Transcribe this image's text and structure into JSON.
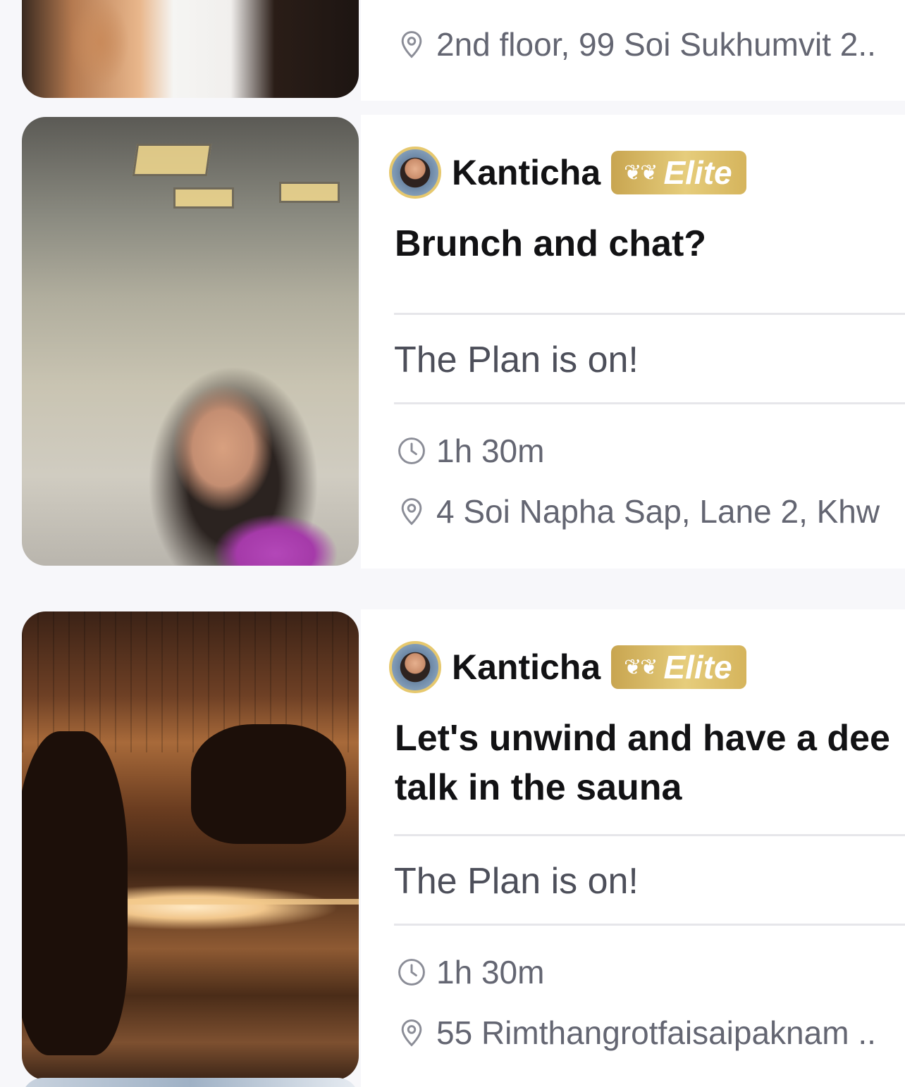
{
  "cards": [
    {
      "address": "2nd floor, 99 Soi Sukhumvit 2..",
      "address_icon": "location-pin-icon"
    },
    {
      "host": {
        "name": "Kanticha",
        "badge": "Elite",
        "badge_icon": "laurel-icon"
      },
      "title": "Brunch and chat?",
      "status": "The Plan is on!",
      "duration": "1h 30m",
      "duration_icon": "clock-icon",
      "address": "4 Soi Napha Sap, Lane 2, Khw",
      "address_icon": "location-pin-icon"
    },
    {
      "host": {
        "name": "Kanticha",
        "badge": "Elite",
        "badge_icon": "laurel-icon"
      },
      "title": "Let's unwind and have a dee\ntalk in the sauna",
      "status": "The Plan is on!",
      "duration": "1h 30m",
      "duration_icon": "clock-icon",
      "address": "55 Rimthangrotfaisaipaknam ..",
      "address_icon": "location-pin-icon"
    }
  ],
  "colors": {
    "background": "#f7f7fa",
    "card": "#ffffff",
    "elite_gold": "#d9bb62",
    "text_primary": "#121214",
    "text_secondary": "#646672"
  }
}
